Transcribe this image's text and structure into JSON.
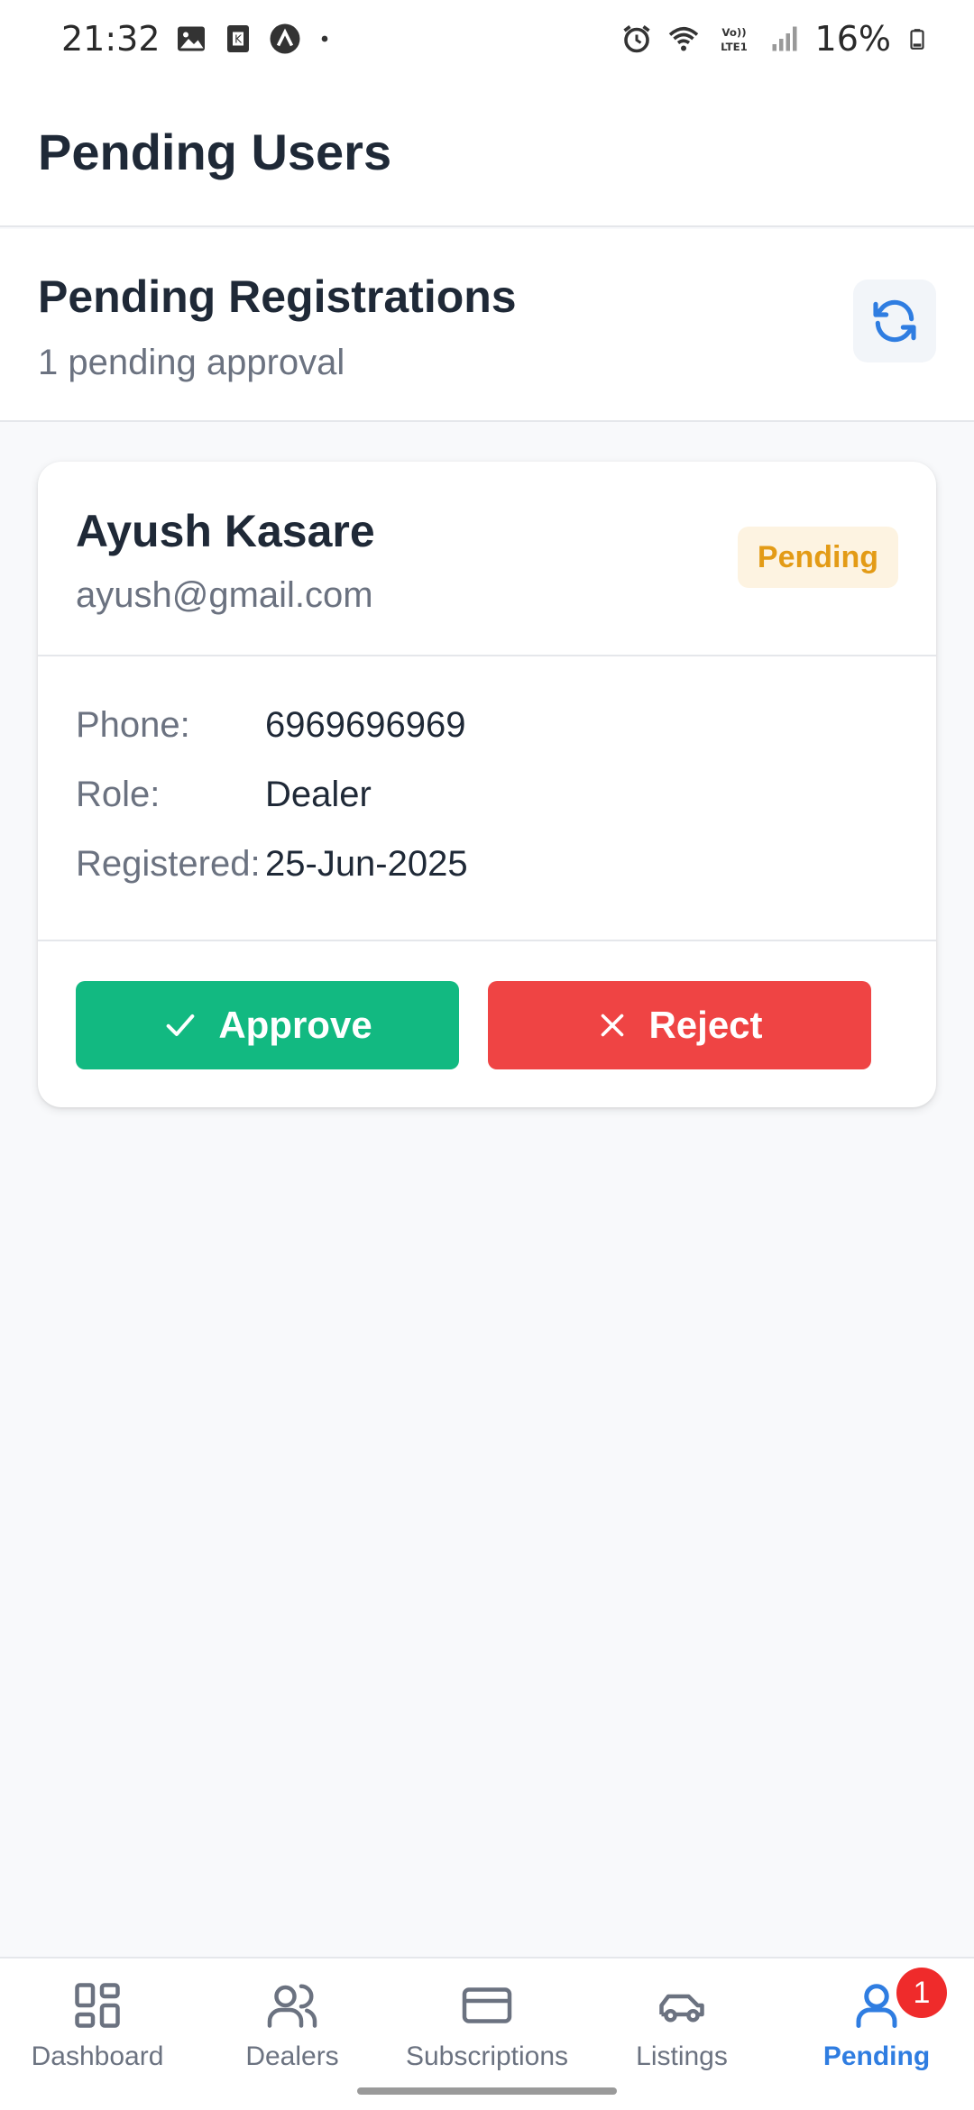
{
  "status_bar": {
    "time": "21:32",
    "battery_percent": "16%",
    "left_icons": [
      "gallery-icon",
      "k-app-icon",
      "expo-icon",
      "dot-icon"
    ],
    "right_icons": [
      "alarm-icon",
      "wifi-icon",
      "volte-icon",
      "signal-icon",
      "battery-icon"
    ]
  },
  "header": {
    "title": "Pending Users"
  },
  "section": {
    "title": "Pending Registrations",
    "subtitle": "1 pending approval",
    "refresh_icon": "refresh-icon"
  },
  "card": {
    "name": "Ayush Kasare",
    "email": "ayush@gmail.com",
    "status": "Pending",
    "details": [
      {
        "label": "Phone:",
        "value": "6969696969"
      },
      {
        "label": "Role:",
        "value": "Dealer"
      },
      {
        "label": "Registered:",
        "value": "25-Jun-2025"
      }
    ],
    "approve_label": "Approve",
    "reject_label": "Reject"
  },
  "nav": {
    "items": [
      {
        "label": "Dashboard",
        "icon": "dashboard-icon"
      },
      {
        "label": "Dealers",
        "icon": "users-icon"
      },
      {
        "label": "Subscriptions",
        "icon": "credit-card-icon"
      },
      {
        "label": "Listings",
        "icon": "car-icon"
      },
      {
        "label": "Pending",
        "icon": "user-icon",
        "badge": "1",
        "active": true
      }
    ]
  },
  "colors": {
    "accent": "#2f7de1",
    "approve": "#12b981",
    "reject": "#ef4444",
    "pending_badge_text": "#e39b16",
    "pending_badge_bg": "#fdf3e1",
    "nav_badge": "#ef2b2b"
  }
}
